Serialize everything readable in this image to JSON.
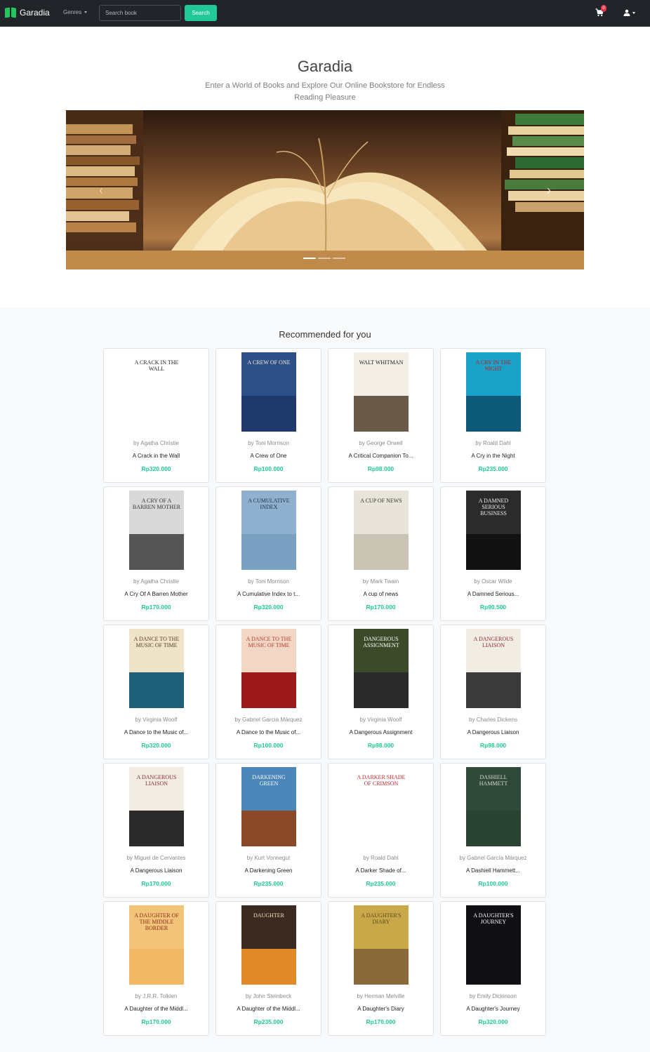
{
  "navbar": {
    "brand": "Garadia",
    "genres_label": "Genres",
    "search_placeholder": "Search book",
    "search_label": "Search",
    "cart_count": "0"
  },
  "hero": {
    "title": "Garadia",
    "subtitle": "Enter a World of Books and Explore Our Online Bookstore for Endless Reading Pleasure",
    "carousel_prev": "‹",
    "carousel_next": "›"
  },
  "recommended": {
    "title": "Recommended for you",
    "books": [
      {
        "author": "by Agatha Christie",
        "title": "A Crack in the Wall",
        "price": "Rp320.000",
        "cover_text": "A Crack in the Wall",
        "cover_bg": "#ffffff",
        "cover_fg": "#222222",
        "band": "#ffffff"
      },
      {
        "author": "by Toni Morrison",
        "title": "A Crew of One",
        "price": "Rp100.000",
        "cover_text": "A Crew of One",
        "cover_bg": "#2e4f86",
        "cover_fg": "#f3ecd9",
        "band": "#1f3a6a"
      },
      {
        "author": "by George Orwell",
        "title": "A Critical Companion To...",
        "price": "Rp98.000",
        "cover_text": "Walt Whitman",
        "cover_bg": "#f4efe6",
        "cover_fg": "#222222",
        "band": "#6b5a4a"
      },
      {
        "author": "by Roald Dahl",
        "title": "A Cry in the Night",
        "price": "Rp235.000",
        "cover_text": "A Cry in the Night",
        "cover_bg": "#1aa3c9",
        "cover_fg": "#c2181d",
        "band": "#0d5a78"
      },
      {
        "author": "by Agatha Christie",
        "title": "A Cry Of A Barren Mother",
        "price": "Rp170.000",
        "cover_text": "A Cry of a Barren Mother",
        "cover_bg": "#d9d9d9",
        "cover_fg": "#333333",
        "band": "#555555"
      },
      {
        "author": "by Toni Morrison",
        "title": "A Cumulative Index to t...",
        "price": "Rp320.000",
        "cover_text": "A Cumulative Index",
        "cover_bg": "#8fb1cf",
        "cover_fg": "#1c2f45",
        "band": "#7aa0c2"
      },
      {
        "author": "by Mark Twain",
        "title": "A cup of news",
        "price": "Rp170.000",
        "cover_text": "A Cup of News",
        "cover_bg": "#e8e4da",
        "cover_fg": "#333333",
        "band": "#c9c3b3"
      },
      {
        "author": "by Oscar Wilde",
        "title": "A Damned Serious...",
        "price": "Rp90.500",
        "cover_text": "A Damned Serious Business",
        "cover_bg": "#2b2b2b",
        "cover_fg": "#f0f0f0",
        "band": "#111111"
      },
      {
        "author": "by Virginia Woolf",
        "title": "A Dance to the Music of...",
        "price": "Rp320.000",
        "cover_text": "A Dance to the Music of Time",
        "cover_bg": "#efe3c8",
        "cover_fg": "#5a3a1a",
        "band": "#1e5f7a"
      },
      {
        "author": "by Gabriel García Márquez",
        "title": "A Dance to the Music of...",
        "price": "Rp100.000",
        "cover_text": "A Dance to the Music of Time",
        "cover_bg": "#f2d7c6",
        "cover_fg": "#b33a2a",
        "band": "#9c1a1a"
      },
      {
        "author": "by Virginia Woolf",
        "title": "A Dangerous Assignment",
        "price": "Rp98.000",
        "cover_text": "Dangerous Assignment",
        "cover_bg": "#3d4a2a",
        "cover_fg": "#ffffff",
        "band": "#2a2a2a"
      },
      {
        "author": "by Charles Dickens",
        "title": "A Dangerous Liaison",
        "price": "Rp98.000",
        "cover_text": "A Dangerous Liaison",
        "cover_bg": "#f1ece4",
        "cover_fg": "#8a2a2a",
        "band": "#3a3a3a"
      },
      {
        "author": "by Miguel de Cervantes",
        "title": "A Dangerous Liaison",
        "price": "Rp170.000",
        "cover_text": "A Dangerous Liaison",
        "cover_bg": "#f1ece4",
        "cover_fg": "#8a2a2a",
        "band": "#2a2a2a"
      },
      {
        "author": "by Kurt Vonnegut",
        "title": "A Darkening Green",
        "price": "Rp235.000",
        "cover_text": "Darkening Green",
        "cover_bg": "#4a86b8",
        "cover_fg": "#ffffff",
        "band": "#8a4a2a"
      },
      {
        "author": "by Roald Dahl",
        "title": "A Darker Shade of...",
        "price": "Rp235.000",
        "cover_text": "A Darker Shade of Crimson",
        "cover_bg": "#ffffff",
        "cover_fg": "#c0282a",
        "band": "#ffffff"
      },
      {
        "author": "by Gabriel García Márquez",
        "title": "A Dashiell Hammett...",
        "price": "Rp100.000",
        "cover_text": "Dashiell Hammett",
        "cover_bg": "#2f4a3a",
        "cover_fg": "#d9d9c9",
        "band": "#2a4232"
      },
      {
        "author": "by J.R.R. Tolkien",
        "title": "A Daughter of the Middl...",
        "price": "Rp170.000",
        "cover_text": "A Daughter of the Middle Border",
        "cover_bg": "#f2c47a",
        "cover_fg": "#8a2a1a",
        "band": "#f0b865"
      },
      {
        "author": "by John Steinbeck",
        "title": "A Daughter of the Middl...",
        "price": "Rp235.000",
        "cover_text": "Daughter",
        "cover_bg": "#3a2a20",
        "cover_fg": "#f2e0c0",
        "band": "#e08a2a"
      },
      {
        "author": "by Herman Melville",
        "title": "A Daughter's Diary",
        "price": "Rp170.000",
        "cover_text": "A Daughter's Diary",
        "cover_bg": "#c9a84a",
        "cover_fg": "#5a4a1a",
        "band": "#8a6a3a"
      },
      {
        "author": "by Emily Dickinson",
        "title": "A Daughter's Journey",
        "price": "Rp320.000",
        "cover_text": "A Daughter's Journey",
        "cover_bg": "#0f0f14",
        "cover_fg": "#ffffff",
        "band": "#0f0f14"
      }
    ]
  }
}
